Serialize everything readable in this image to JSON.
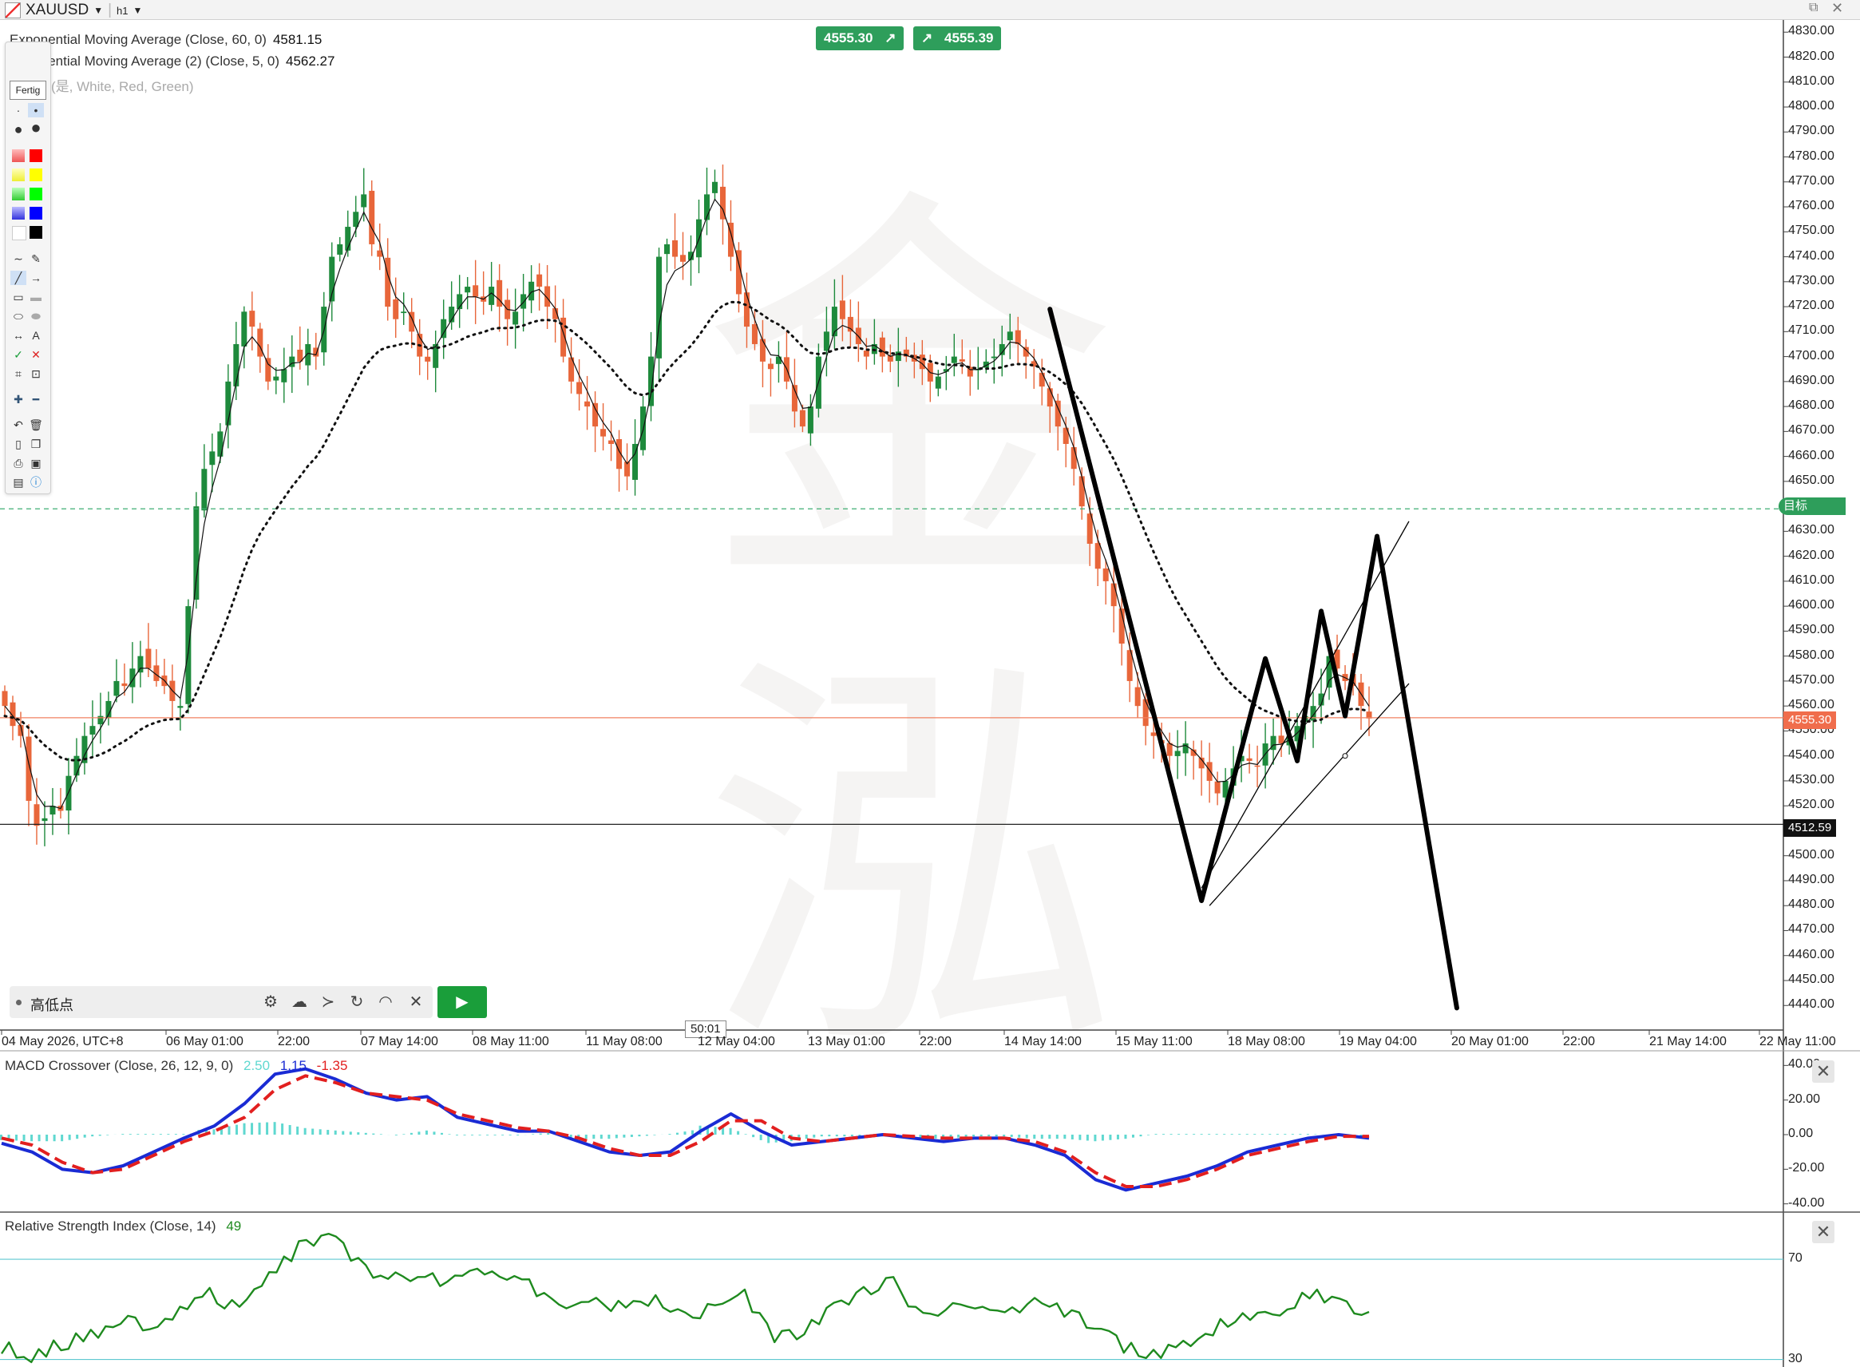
{
  "window": {
    "symbol": "XAUUSD",
    "timeframe": "h1",
    "corner_icons": [
      "restore-icon",
      "close-icon"
    ]
  },
  "indicators": {
    "ema60": {
      "label": "Exponential Moving Average (Close, 60, 0)",
      "value": "4581.15"
    },
    "ema5": {
      "label": "Exponential Moving Average (2) (Close, 5, 0)",
      "value": "4562.27"
    },
    "points": {
      "label": "Points (是, White, Red, Green)"
    }
  },
  "pills": {
    "sell": "4555.30",
    "buy": "4555.39"
  },
  "toolbox": {
    "fertig": "Fertig"
  },
  "bottom_toolbar": {
    "label": "高低点"
  },
  "price_labels": {
    "current": "4555.30",
    "line2": "4512.59",
    "target": "目标"
  },
  "cursor_time": "50:01",
  "colors": {
    "up": "#1e8a3c",
    "down": "#e8663a",
    "macd": "#1a2bd4",
    "signal": "#e21f1f",
    "hist": "#5fd8d0",
    "rsi": "#1e8a1e",
    "target_line": "#3fae73",
    "current_line": "#f08060"
  },
  "chart_data": [
    {
      "type": "candlestick",
      "symbol": "XAUUSD",
      "y_axis": {
        "ticks": [
          "4830.00",
          "4820.00",
          "4810.00",
          "4800.00",
          "4790.00",
          "4780.00",
          "4770.00",
          "4760.00",
          "4750.00",
          "4740.00",
          "4730.00",
          "4720.00",
          "4710.00",
          "4700.00",
          "4690.00",
          "4680.00",
          "4670.00",
          "4660.00",
          "4650.00",
          "4640.00",
          "4630.00",
          "4620.00",
          "4610.00",
          "4600.00",
          "4590.00",
          "4580.00",
          "4570.00",
          "4560.00",
          "4550.00",
          "4540.00",
          "4530.00",
          "4520.00",
          "4510.00",
          "4500.00",
          "4490.00",
          "4480.00",
          "4470.00",
          "4460.00",
          "4450.00",
          "4440.00"
        ],
        "range": [
          4434,
          4832
        ]
      },
      "x_axis": {
        "ticks": [
          "04 May 2026, UTC+8",
          "06 May 01:00",
          "22:00",
          "07 May 14:00",
          "08 May 11:00",
          "11 May 08:00",
          "12 May 04:00",
          "13 May 01:00",
          "22:00",
          "14 May 14:00",
          "15 May 11:00",
          "18 May 08:00",
          "19 May 04:00",
          "20 May 01:00",
          "22:00",
          "21 May 14:00",
          "22 May 11:00"
        ]
      },
      "closes": [
        4560,
        4552,
        4548,
        4522,
        4512,
        4515,
        4520,
        4518,
        4532,
        4540,
        4548,
        4552,
        4556,
        4562,
        4570,
        4568,
        4575,
        4580,
        4575,
        4570,
        4568,
        4562,
        4560,
        4600,
        4640,
        4655,
        4662,
        4670,
        4690,
        4705,
        4718,
        4712,
        4700,
        4690,
        4692,
        4695,
        4700,
        4698,
        4705,
        4700,
        4720,
        4740,
        4745,
        4752,
        4758,
        4765,
        4745,
        4740,
        4720,
        4715,
        4718,
        4710,
        4700,
        4698,
        4705,
        4715,
        4720,
        4725,
        4728,
        4724,
        4722,
        4728,
        4720,
        4715,
        4718,
        4725,
        4730,
        4728,
        4720,
        4715,
        4700,
        4690,
        4685,
        4680,
        4672,
        4668,
        4665,
        4655,
        4652,
        4665,
        4680,
        4700,
        4740,
        4745,
        4740,
        4738,
        4742,
        4755,
        4765,
        4770,
        4755,
        4740,
        4725,
        4712,
        4705,
        4698,
        4695,
        4700,
        4690,
        4678,
        4672,
        4680,
        4700,
        4710,
        4720,
        4715,
        4710,
        4705,
        4700,
        4705,
        4700,
        4698,
        4702,
        4700,
        4698,
        4695,
        4690,
        4692,
        4695,
        4700,
        4698,
        4692,
        4695,
        4698,
        4700,
        4705,
        4710,
        4705,
        4700,
        4696,
        4688,
        4680,
        4672,
        4665,
        4655,
        4640,
        4625,
        4615,
        4610,
        4600,
        4585,
        4570,
        4560,
        4552,
        4548,
        4545,
        4540,
        4542,
        4545,
        4540,
        4535,
        4530,
        4525,
        4530,
        4535,
        4540,
        4538,
        4536,
        4545,
        4548,
        4545,
        4548,
        4552,
        4556,
        4560,
        4565,
        4580,
        4575,
        4570,
        4568,
        4560,
        4555
      ],
      "ema5": "thin black line following closes",
      "ema60": "dotted black line",
      "horizontal_lines": [
        {
          "label": "目标",
          "value": 4639,
          "style": "dashed"
        },
        {
          "value": 4555.3,
          "style": "solid"
        },
        {
          "value": 4512.59,
          "style": "solid"
        }
      ],
      "drawings": {
        "zigzag_path": [
          [
            131,
            4719
          ],
          [
            150,
            4482
          ],
          [
            158,
            4579
          ],
          [
            162,
            4538
          ],
          [
            165,
            4598
          ],
          [
            168,
            4556
          ],
          [
            172,
            4628
          ],
          [
            182,
            4439
          ]
        ],
        "channel_upper": [
          [
            150,
            4487
          ],
          [
            176,
            4634
          ]
        ],
        "channel_lower": [
          [
            151,
            4480
          ],
          [
            176,
            4569
          ]
        ],
        "marker": [
          168,
          4540
        ]
      }
    },
    {
      "type": "line",
      "title": "MACD Crossover (Close, 26, 12, 9, 0)",
      "values_shown": [
        "2.50",
        "1.15",
        "-1.35"
      ],
      "y_axis": {
        "ticks": [
          "40.00",
          "20.00",
          "0.00",
          "-20.00",
          "-40.00"
        ],
        "range": [
          -42,
          42
        ]
      },
      "series": [
        {
          "values": [
            -5,
            -10,
            -20,
            -22,
            -18,
            -10,
            -2,
            5,
            18,
            35,
            38,
            32,
            24,
            20,
            22,
            10,
            6,
            2,
            2,
            -4,
            -10,
            -12,
            -10,
            2,
            12,
            2,
            -6,
            -4,
            -2,
            0,
            -2,
            -4,
            -2,
            -2,
            -6,
            -12,
            -26,
            -32,
            -28,
            -24,
            -18,
            -10,
            -6,
            -2,
            0,
            -2
          ]
        },
        {
          "values": [
            -2,
            -6,
            -16,
            -22,
            -20,
            -12,
            -4,
            2,
            10,
            26,
            34,
            30,
            24,
            22,
            20,
            12,
            8,
            4,
            2,
            -2,
            -8,
            -12,
            -12,
            -4,
            8,
            8,
            -2,
            -4,
            -2,
            0,
            -1,
            -2,
            -2,
            -2,
            -4,
            -10,
            -22,
            -30,
            -30,
            -26,
            -20,
            -12,
            -8,
            -4,
            -1,
            -1
          ]
        }
      ]
    },
    {
      "type": "line",
      "title": "Relative Strength Index (Close, 14)",
      "value_shown": "49",
      "y_axis": {
        "ticks": [
          "70",
          "30"
        ],
        "range": [
          27,
          85
        ]
      },
      "series": [
        {
          "values": [
            35,
            31,
            36,
            40,
            46,
            44,
            50,
            56,
            50,
            62,
            75,
            80,
            68,
            62,
            64,
            60,
            66,
            62,
            58,
            48,
            52,
            50,
            54,
            48,
            50,
            56,
            38,
            42,
            50,
            56,
            62,
            46,
            52,
            50,
            50,
            54,
            48,
            40,
            34,
            32,
            38,
            44,
            46,
            50,
            56,
            52,
            49
          ]
        }
      ]
    }
  ]
}
